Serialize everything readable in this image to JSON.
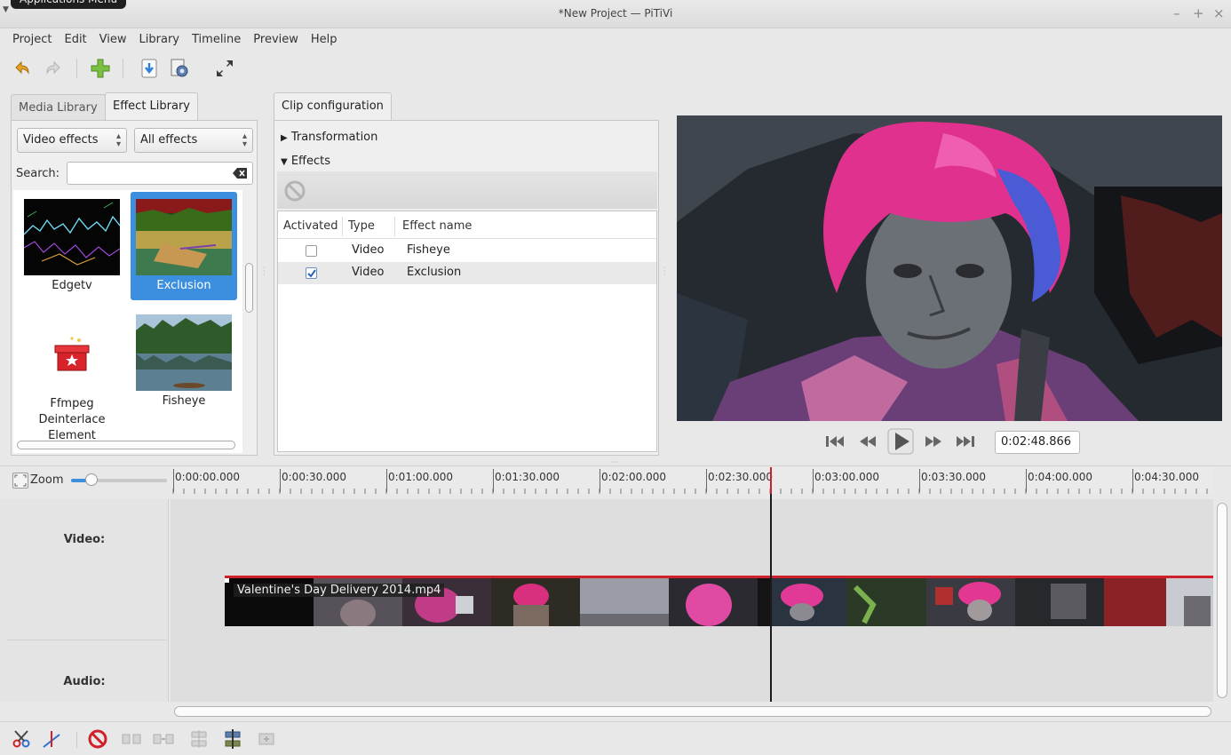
{
  "window": {
    "tooltip": "Applications Menu",
    "title": "*New Project — PiTiVi",
    "controls": [
      "–",
      "+",
      "×"
    ]
  },
  "menu": [
    "Project",
    "Edit",
    "View",
    "Library",
    "Timeline",
    "Preview",
    "Help"
  ],
  "library": {
    "tabs": [
      "Media Library",
      "Effect Library"
    ],
    "active_tab": "Effect Library",
    "category_combo": "Video effects",
    "filter_combo": "All effects",
    "search_label": "Search:",
    "search_value": "",
    "effects": [
      {
        "name": "Edgetv",
        "selected": false
      },
      {
        "name": "Exclusion",
        "selected": true
      },
      {
        "name": "Ffmpeg Deinterlace Element",
        "selected": false
      },
      {
        "name": "Fisheye",
        "selected": false
      }
    ]
  },
  "clip_config": {
    "tab": "Clip configuration",
    "sections": [
      {
        "label": "Transformation",
        "expanded": false
      },
      {
        "label": "Effects",
        "expanded": true
      }
    ],
    "columns": [
      "Activated",
      "Type",
      "Effect name"
    ],
    "rows": [
      {
        "activated": false,
        "type": "Video",
        "name": "Fisheye"
      },
      {
        "activated": true,
        "type": "Video",
        "name": "Exclusion"
      }
    ]
  },
  "viewer": {
    "timecode": "0:02:48.866"
  },
  "timeline": {
    "zoom_label": "Zoom",
    "ruler": [
      "0:00:00.000",
      "0:00:30.000",
      "0:01:00.000",
      "0:01:30.000",
      "0:02:00.000",
      "0:02:30.000",
      "0:03:00.000",
      "0:03:30.000",
      "0:04:00.000",
      "0:04:30.000"
    ],
    "tracks": {
      "video": "Video:",
      "audio": "Audio:"
    },
    "clip_name": "Valentine's Day Delivery 2014.mp4",
    "playhead_seconds": 168.866
  },
  "colors": {
    "selection": "#3c8fde",
    "playhead": "#d0202a",
    "clip_border": "#d0202a"
  }
}
